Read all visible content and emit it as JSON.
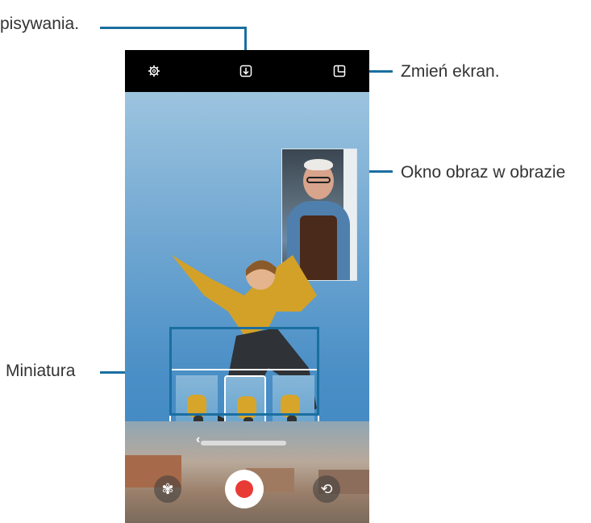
{
  "callouts": {
    "recording_mode": "pisywania.",
    "change_screen": "Zmień ekran.",
    "pip_window": "Okno obraz w obrazie",
    "thumbnail": "Miniatura"
  },
  "icons": {
    "settings": "gear-icon",
    "download": "download-icon",
    "screen_layout": "screen-layout-icon",
    "effects": "flower-icon",
    "switch_camera": "switch-camera-icon",
    "chevron": "chevron-left-icon"
  },
  "ui": {
    "chevron_glyph": "‹",
    "effects_glyph": "✾",
    "switch_glyph": "⟲"
  },
  "colors": {
    "record_dot": "#e83b35",
    "callout_line": "#1a6fa0"
  }
}
